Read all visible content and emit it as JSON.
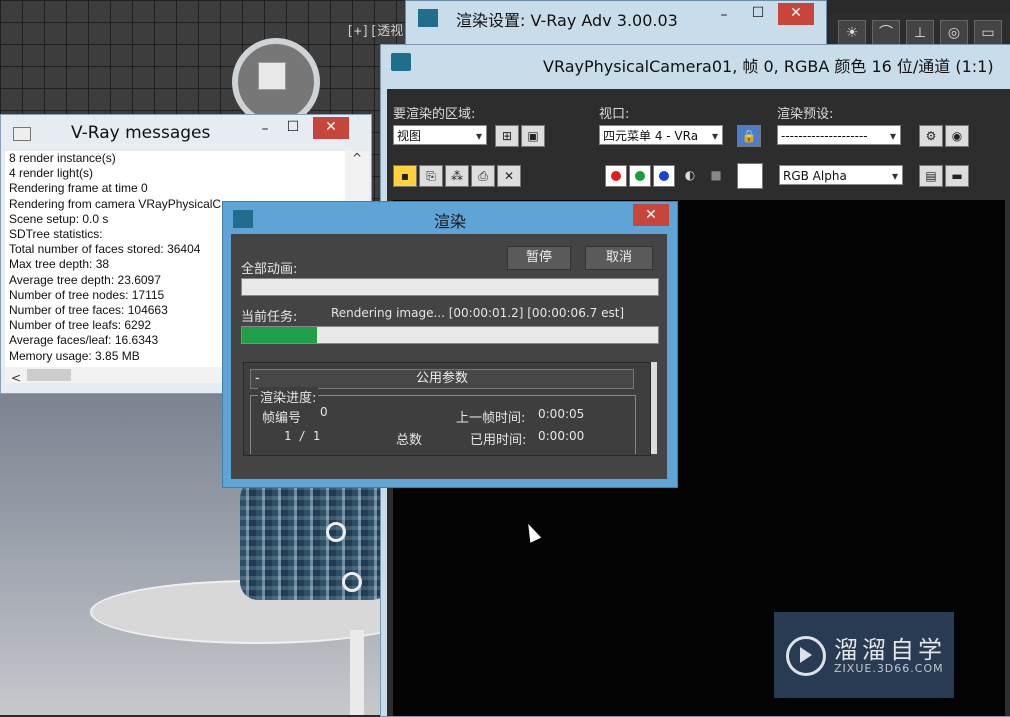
{
  "viewport": {
    "label": "[+][透视"
  },
  "render_settings_window": {
    "title": "渲染设置: V-Ray Adv 3.00.03",
    "minimize": "–",
    "maximize": "☐",
    "close": "✕"
  },
  "frame_buffer": {
    "title": "VRayPhysicalCamera01, 帧 0, RGBA 颜色 16 位/通道 (1:1)",
    "render_area_label": "要渲染的区域:",
    "render_area_value": "视图",
    "viewport_label": "视口:",
    "viewport_value": "四元菜单 4 - VRa",
    "preset_label": "渲染预设:",
    "preset_value": "--------------------",
    "channel_value": "RGB Alpha",
    "colors": {
      "red": "#e02020",
      "green": "#14a032",
      "blue": "#1840d8"
    }
  },
  "vray_messages": {
    "title": "V-Ray messages",
    "minimize": "–",
    "maximize": "☐",
    "close": "✕",
    "lines": [
      "8 render instance(s)",
      "4 render light(s)",
      "Rendering frame at time 0",
      "Rendering from camera VRayPhysicalC",
      "Scene setup: 0.0 s",
      "SDTree statistics:",
      "Total number of faces stored: 36404",
      "Max tree depth: 38",
      "Average tree depth: 23.6097",
      "Number of tree nodes: 17115",
      "Number of tree faces: 104663",
      "Number of tree leafs: 6292",
      "Average faces/leaf: 16.6343",
      "Memory usage: 3.85 MB"
    ]
  },
  "render_dialog": {
    "title": "渲染",
    "close": "✕",
    "total_animation_label": "全部动画:",
    "pause_label": "暂停",
    "cancel_label": "取消",
    "current_task_label": "当前任务:",
    "current_task_value": "Rendering image... [00:00:01.2] [00:00:06.7 est]",
    "total_progress": 0,
    "current_progress": 0.18,
    "rollout_minus": "-",
    "rollout_title": "公用参数",
    "group_label": "渲染进度:",
    "frame_label": "帧编号",
    "frame_value": "0",
    "frame_count": "1  /  1",
    "total_label": "总数",
    "last_frame_time_label": "上一帧时间:",
    "last_frame_time_value": "0:00:05",
    "elapsed_label": "已用时间:",
    "elapsed_value": "0:00:00"
  },
  "watermark": {
    "name": "溜溜自学",
    "url": "ZIXUE.3D66.COM"
  }
}
